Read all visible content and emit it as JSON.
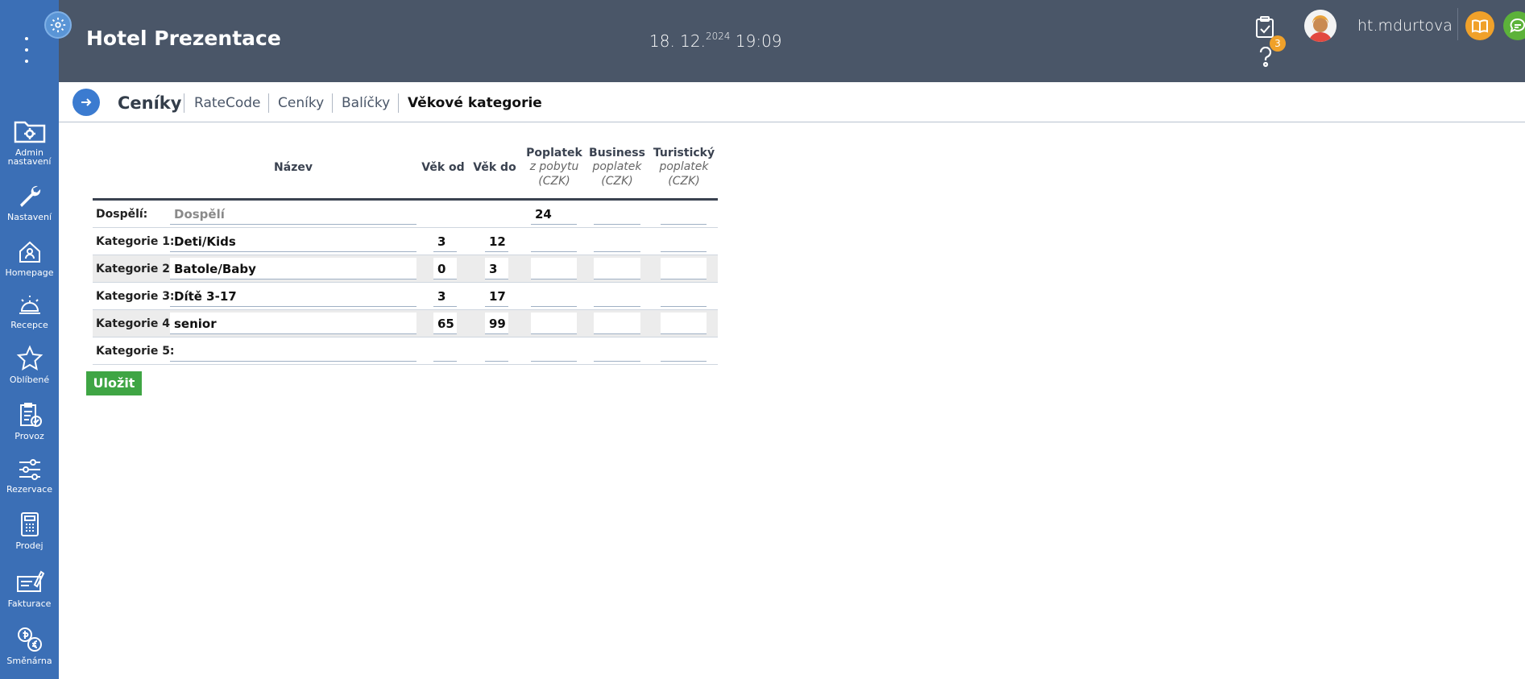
{
  "header": {
    "title": "Hotel Prezentace",
    "date": "18. 12.",
    "year": "2024",
    "time": "19:09",
    "notification_count": "3",
    "username": "ht.mdurtova"
  },
  "sidebar": {
    "items": [
      {
        "label_line1": "Admin",
        "label_line2": "nastavení",
        "icon": "folder-gear-icon"
      },
      {
        "label": "Nastavení",
        "icon": "wrench-icon"
      },
      {
        "label": "Homepage",
        "icon": "home-user-icon"
      },
      {
        "label": "Recepce",
        "icon": "reception-bell-icon"
      },
      {
        "label": "Oblíbené",
        "icon": "star-icon"
      },
      {
        "label": "Provoz",
        "icon": "clipboard-check-icon"
      },
      {
        "label": "Rezervace",
        "icon": "sliders-icon"
      },
      {
        "label": "Prodej",
        "icon": "calculator-icon"
      },
      {
        "label": "Fakturace",
        "icon": "invoice-pen-icon"
      },
      {
        "label": "Směnárna",
        "icon": "currency-exchange-icon"
      }
    ]
  },
  "tabbar": {
    "section": "Ceníky",
    "tabs": [
      {
        "label": "RateCode"
      },
      {
        "label": "Ceníky"
      },
      {
        "label": "Balíčky"
      },
      {
        "label": "Věkové kategorie"
      }
    ]
  },
  "table": {
    "headers": {
      "name": "Název",
      "age_from": "Věk od",
      "age_to": "Věk do",
      "fee1_title": "Poplatek",
      "fee1_sub1": "z pobytu",
      "fee1_sub2": "(CZK)",
      "fee2_title": "Business",
      "fee2_sub1": "poplatek",
      "fee2_sub2": "(CZK)",
      "fee3_title": "Turistický",
      "fee3_sub1": "poplatek",
      "fee3_sub2": "(CZK)"
    },
    "rows": [
      {
        "label": "Dospělí:",
        "name": "",
        "name_placeholder": "Dospělí",
        "age_from": "",
        "age_to": "",
        "fee1": "24",
        "fee2": "",
        "fee3": ""
      },
      {
        "label": "Kategorie 1:",
        "name": "Deti/Kids",
        "age_from": "3",
        "age_to": "12",
        "fee1": "",
        "fee2": "",
        "fee3": ""
      },
      {
        "label": "Kategorie 2:",
        "name": "Batole/Baby",
        "age_from": "0",
        "age_to": "3",
        "fee1": "",
        "fee2": "",
        "fee3": ""
      },
      {
        "label": "Kategorie 3:",
        "name": "Dítě 3-17",
        "age_from": "3",
        "age_to": "17",
        "fee1": "",
        "fee2": "",
        "fee3": ""
      },
      {
        "label": "Kategorie 4:",
        "name": "senior",
        "age_from": "65",
        "age_to": "99",
        "fee1": "",
        "fee2": "",
        "fee3": ""
      },
      {
        "label": "Kategorie 5:",
        "name": "",
        "age_from": "",
        "age_to": "",
        "fee1": "",
        "fee2": "",
        "fee3": ""
      }
    ]
  },
  "actions": {
    "save_label": "Uložit"
  },
  "colors": {
    "sidebar": "#3b6fb6",
    "header": "#4a5668",
    "accent": "#3b7bd0",
    "save": "#3fa544",
    "badge": "#f0a12a",
    "book": "#f0a12a",
    "chat": "#5cb23a",
    "power": "#ffffff"
  }
}
